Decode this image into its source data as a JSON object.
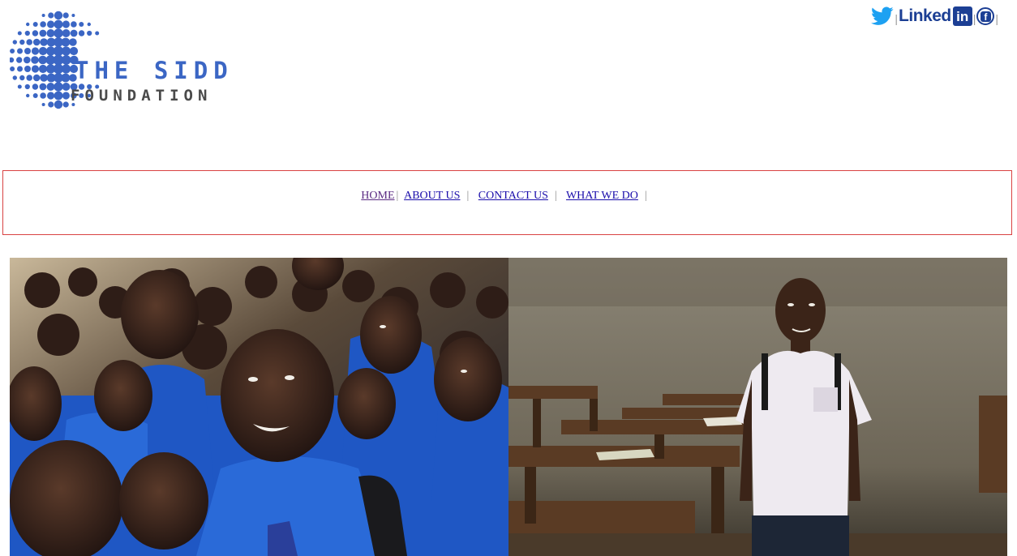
{
  "logo": {
    "title": "THE SIDD",
    "subtitle": "FOUNDATION",
    "icon": "dotted-globe-icon"
  },
  "social": {
    "twitter_icon": "twitter-bird-icon",
    "linkedin_word": "Linked",
    "linkedin_box": "in",
    "facebook_letter": "f",
    "separator": "|"
  },
  "nav": {
    "items": [
      {
        "label": "HOME"
      },
      {
        "label": "ABOUT US"
      },
      {
        "label": "CONTACT US"
      },
      {
        "label": "WHAT WE DO"
      }
    ],
    "separator": "|"
  },
  "hero": {
    "left_image": "photo of smiling schoolchildren in blue uniforms",
    "right_image": "photo of boy in white shirt standing in classroom with wooden desks"
  },
  "colors": {
    "brand_blue": "#3b66c4",
    "social_blue": "#1c3f94",
    "nav_border": "#d94242",
    "link": "#1a0dab"
  }
}
